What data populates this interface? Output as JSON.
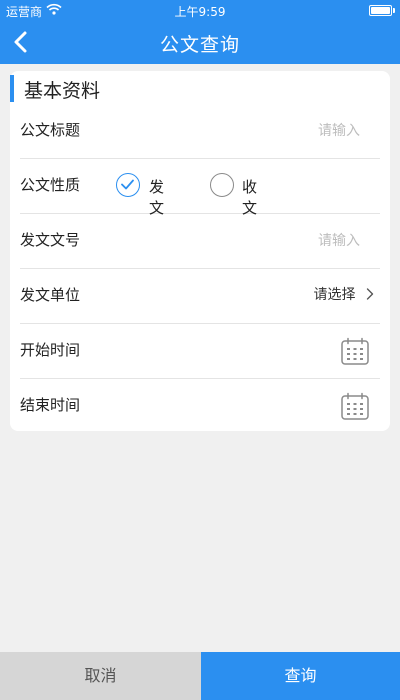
{
  "statusbar": {
    "carrier": "运营商",
    "time": "上午9:59"
  },
  "navbar": {
    "title": "公文查询"
  },
  "section": {
    "title": "基本资料"
  },
  "fields": {
    "title": {
      "label": "公文标题",
      "placeholder": "请输入"
    },
    "nature": {
      "label": "公文性质",
      "options": [
        "发文",
        "收文"
      ],
      "selected": "发文"
    },
    "doc_number": {
      "label": "发文文号",
      "placeholder": "请输入"
    },
    "issuer": {
      "label": "发文单位",
      "value": "请选择"
    },
    "start_time": {
      "label": "开始时间"
    },
    "end_time": {
      "label": "结束时间"
    }
  },
  "buttons": {
    "cancel": "取消",
    "query": "查询"
  },
  "colors": {
    "primary": "#2b8ff0",
    "cancel_bg": "#d6d6d6",
    "page_bg": "#f0f0f0"
  },
  "icons": {
    "back": "chevron-left-icon",
    "calendar": "calendar-icon",
    "check": "check-icon",
    "wifi": "wifi-icon",
    "battery": "battery-icon"
  }
}
